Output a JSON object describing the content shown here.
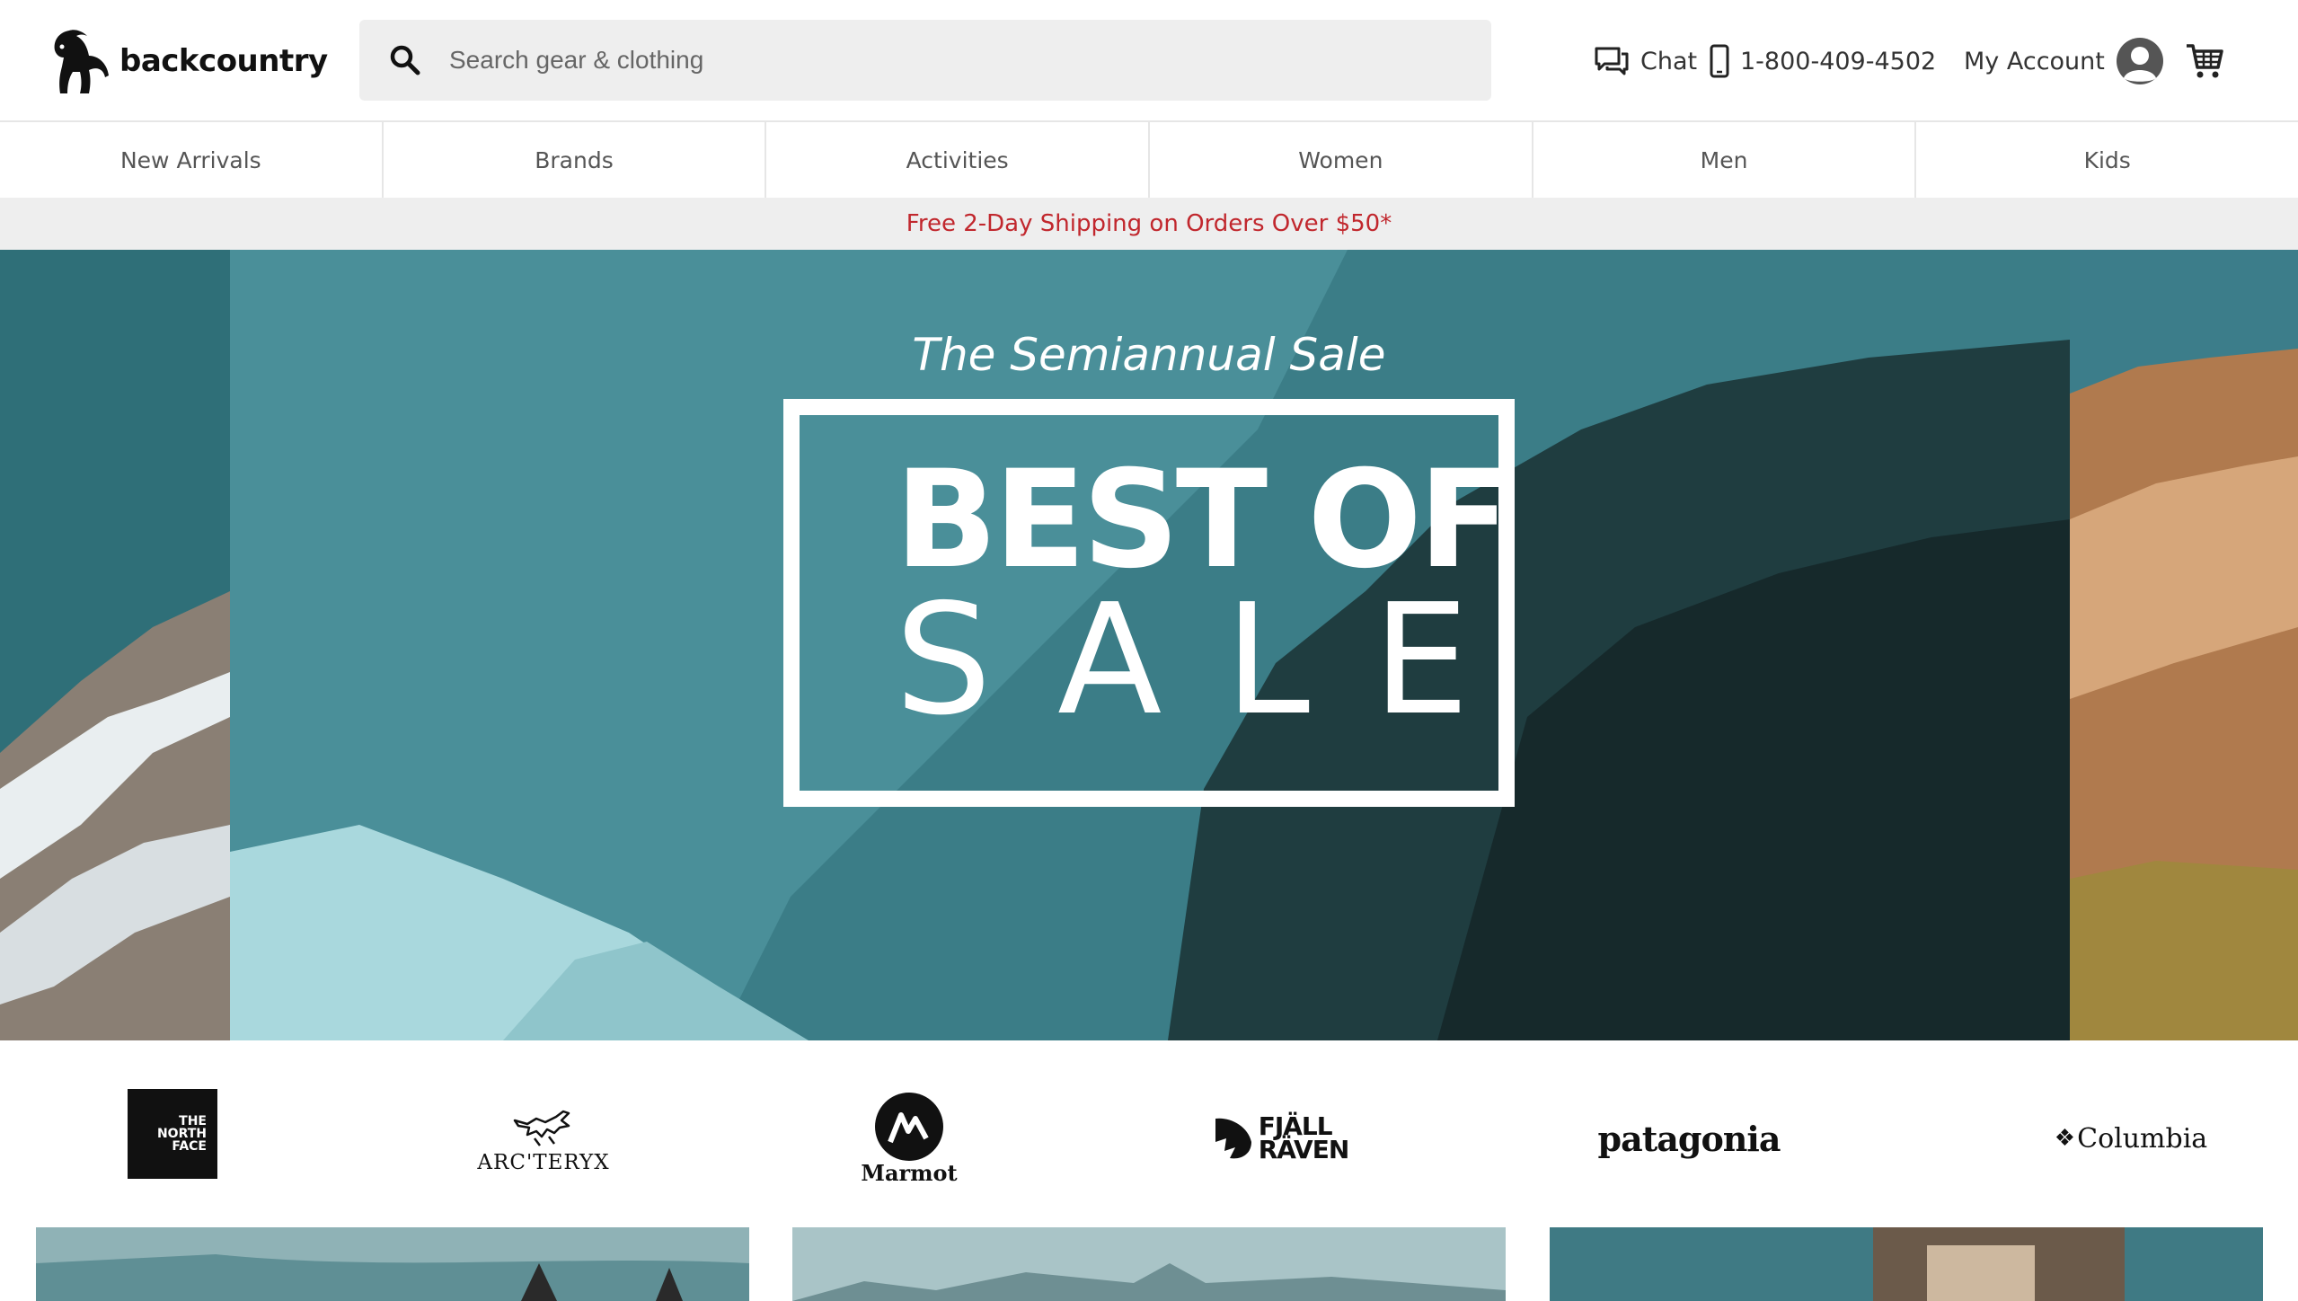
{
  "header": {
    "logo_text": "backcountry",
    "search_placeholder": "Search gear & clothing",
    "chat_label": "Chat",
    "phone_number": "1-800-409-4502",
    "account_label": "My Account"
  },
  "nav": {
    "items": [
      {
        "label": "New Arrivals"
      },
      {
        "label": "Brands"
      },
      {
        "label": "Activities"
      },
      {
        "label": "Women"
      },
      {
        "label": "Men"
      },
      {
        "label": "Kids"
      }
    ]
  },
  "promo": {
    "text": "Free 2-Day Shipping on Orders Over $50*"
  },
  "hero": {
    "subtitle": "The Semiannual Sale",
    "title_line1": "BEST OF",
    "title_line2": "SALE"
  },
  "brands": {
    "tnf": [
      "THE",
      "NORTH",
      "FACE"
    ],
    "arcteryx": "ARC'TERYX",
    "marmot": "Marmot",
    "fjallraven": [
      "FJÄLL",
      "RÄVEN"
    ],
    "patagonia": "patagonia",
    "columbia": "Columbia"
  },
  "colors": {
    "promo_text": "#c1272d",
    "hero_teal": "#4a8f99"
  },
  "icons": {
    "search": "search-icon",
    "chat": "chat-icon",
    "phone": "phone-icon",
    "account": "account-avatar-icon",
    "cart": "cart-icon"
  }
}
